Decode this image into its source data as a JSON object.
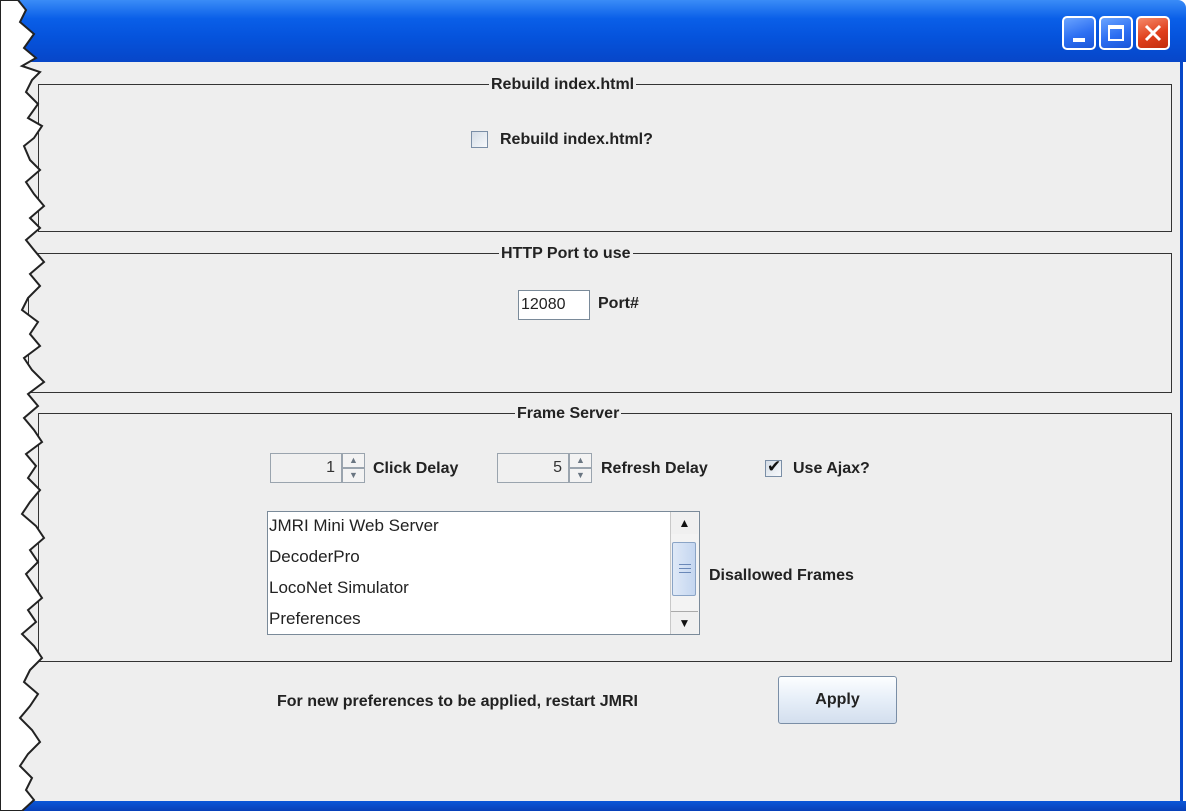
{
  "window": {
    "title_buttons": [
      "minimize-icon",
      "maximize-icon",
      "close-icon"
    ]
  },
  "rebuild": {
    "group_title": "Rebuild index.html",
    "checkbox_label": "Rebuild index.html?",
    "checked": false
  },
  "port": {
    "group_title": "HTTP Port to use",
    "value": "12080",
    "label": "Port#"
  },
  "frame_server": {
    "group_title": "Frame Server",
    "click_delay": {
      "value": "1",
      "label": "Click Delay"
    },
    "refresh_delay": {
      "value": "5",
      "label": "Refresh Delay"
    },
    "use_ajax": {
      "label": "Use Ajax?",
      "checked": true
    },
    "disallowed_frames": {
      "label": "Disallowed Frames",
      "items": [
        "JMRI Mini Web Server",
        "DecoderPro",
        "LocoNet Simulator",
        "Preferences"
      ]
    }
  },
  "footer": {
    "note": "For new preferences to be applied, restart JMRI",
    "apply_label": "Apply"
  },
  "colors": {
    "titlebar": "#0553dc",
    "background": "#eeeeee",
    "close_button": "#e0401c"
  }
}
